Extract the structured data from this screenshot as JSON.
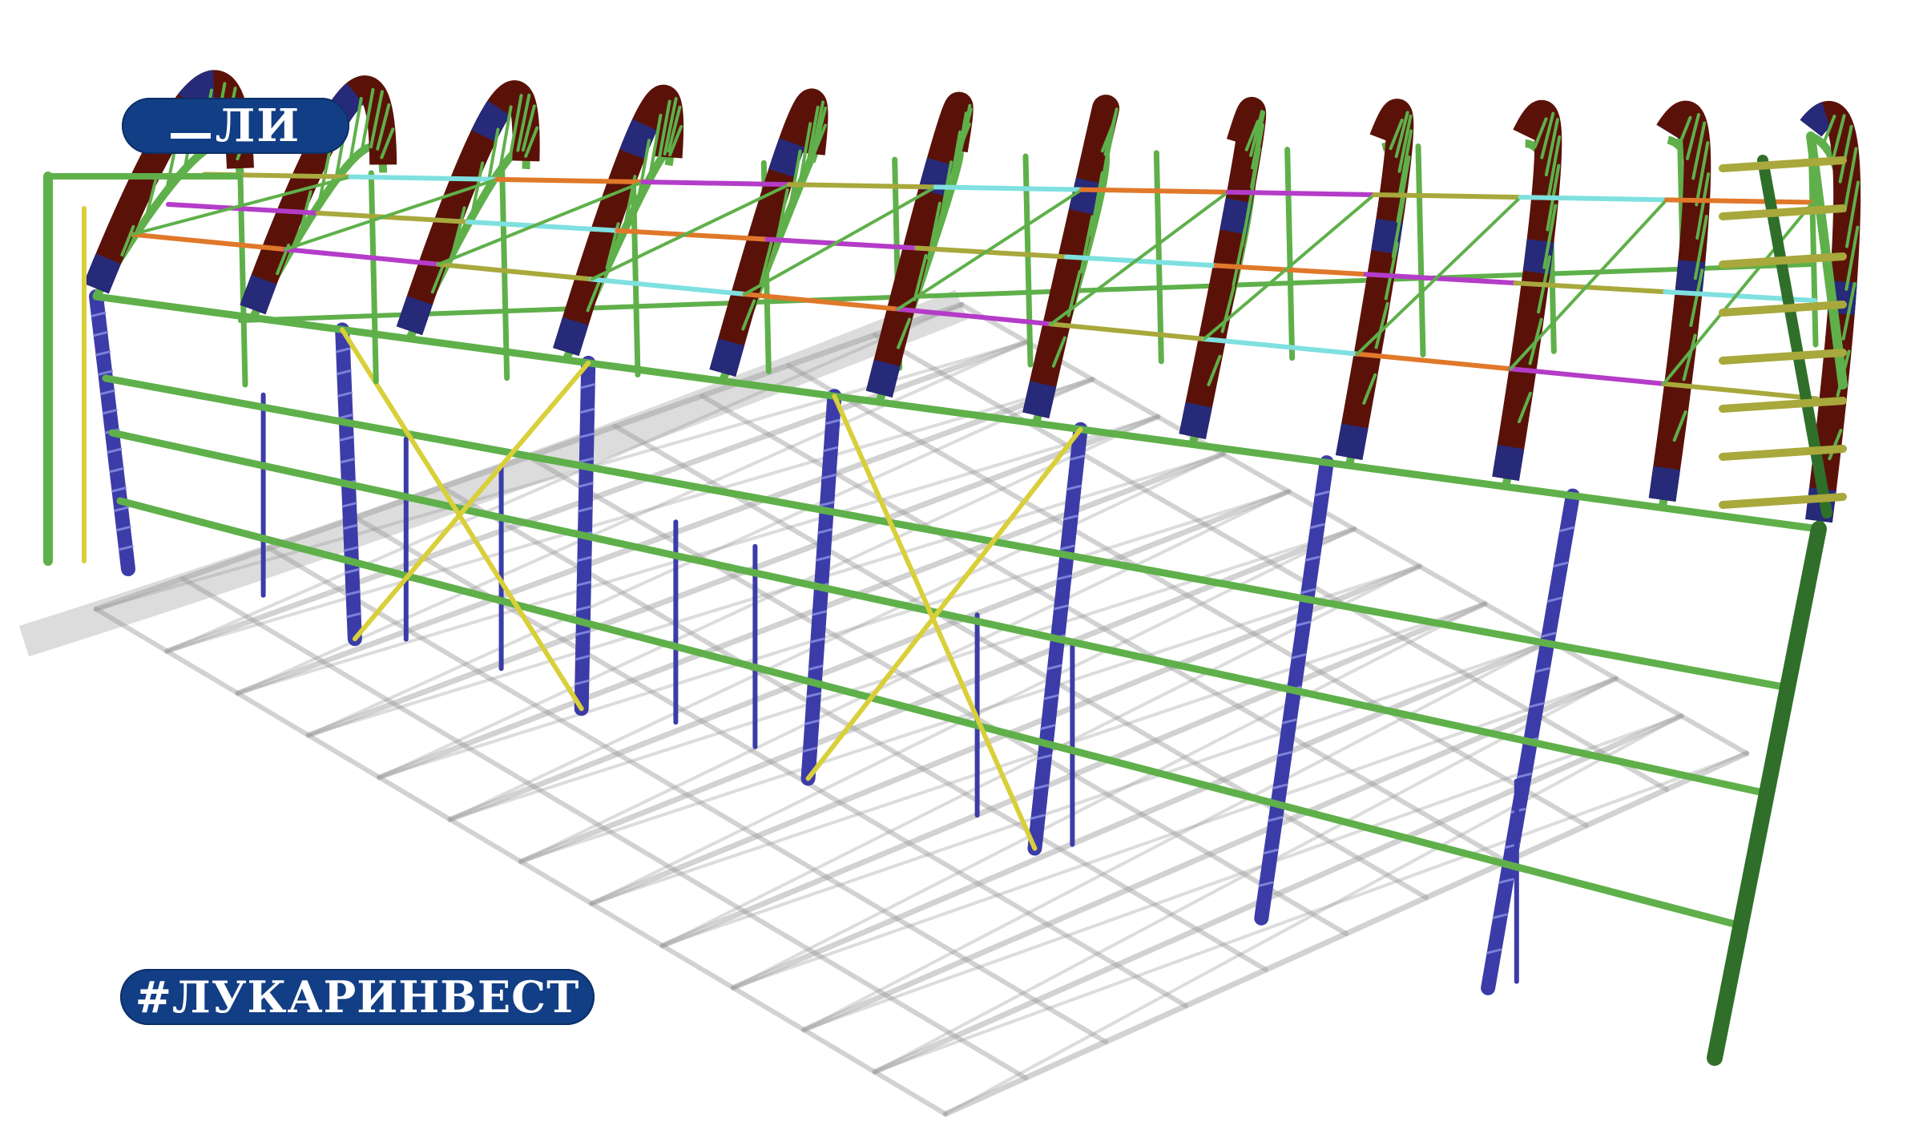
{
  "logo": {
    "text": "ЛИ",
    "brand_color": "#123e85",
    "text_color": "#ffffff"
  },
  "hashtag": {
    "text": "#ЛУКАРИНВЕСТ",
    "brand_color": "#123e85",
    "text_color": "#ffffff"
  },
  "palette": {
    "background": "#ffffff",
    "roof_arch_brown": "#5a1208",
    "roof_arch_navy": "#262a78",
    "frame_green": "#5fb04a",
    "frame_green_dark": "#2f6f2a",
    "column_blue": "#3c3ca8",
    "column_lattice": "#7b82d8",
    "brace_yellow": "#d9cf3a",
    "strut_orange": "#e0782a",
    "strut_cyan": "#7fe0e0",
    "strut_magenta": "#b43cc8",
    "strut_olive": "#a8a83c",
    "shadow_gray": "#9c9c9c"
  }
}
